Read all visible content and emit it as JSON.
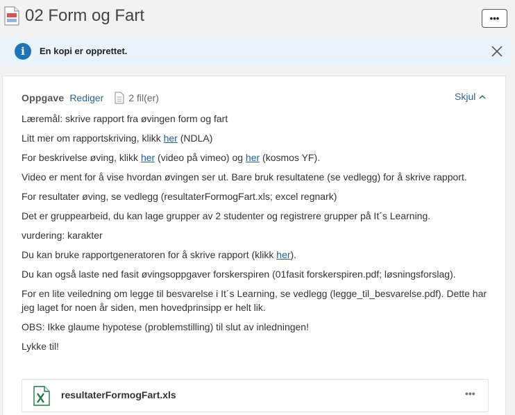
{
  "header": {
    "title": "02 Form og Fart",
    "more_label": "•••"
  },
  "alert": {
    "message": "En kopi er opprettet."
  },
  "task": {
    "label": "Oppgave",
    "edit_label": "Rediger",
    "file_count": "2 fil(er)",
    "hide_label": "Skjul"
  },
  "content": {
    "p1": "Læremål: skrive rapport fra øvingen form og fart",
    "p2_before": "Litt mer om rapportskriving, klikk ",
    "p2_link": "her",
    "p2_after": " (NDLA)",
    "p3_before": "For beskrivelse øving, klikk ",
    "p3_link1": "her",
    "p3_mid": " (video på vimeo) og ",
    "p3_link2": "her",
    "p3_after": " (kosmos YF).",
    "p4": "Video er ment for å vise hvordan øvingen ser ut. Bare bruk resultatene (se vedlegg) for å skrive rapport.",
    "p5": "For resultater øving, se vedlegg (resultaterFormogFart.xls; excel regnark)",
    "p6": "Det er gruppearbeid, du kan lage grupper av 2 studenter og registrere grupper på It´s Learning.",
    "p7": "vurdering: karakter",
    "p8_before": "Du kan bruke rapportgeneratoren for å skrive rapport (klikk ",
    "p8_link": "her",
    "p8_after": ").",
    "p9": "Du kan også laste ned fasit øvingsoppgaver forskerspiren (01fasit forskerspiren.pdf; løsningsforslag).",
    "p10": "For en lite veiledning om legge til besvarelse i It´s Learning, se vedlegg (legge_til_besvarelse.pdf). Dette har jeg laget for noen år siden, men hovedprinsipp er helt lik.",
    "p11": "OBS: Ikke glaume hypotese (problemstilling) til slut av inledningen!",
    "p12": "Lykke til!"
  },
  "attachment": {
    "filename": "resultaterFormogFart.xls",
    "more_label": "•••"
  },
  "colors": {
    "accent": "#1f74b8",
    "link": "#1a5fa6",
    "alert_bg": "#e8f3fb",
    "excel_green": "#1e7b45"
  },
  "icons": {
    "page": "document-icon",
    "info": "info-icon",
    "close": "close-icon",
    "file": "file-icon",
    "collapse": "chevron-up-icon",
    "attachment": "excel-icon"
  }
}
